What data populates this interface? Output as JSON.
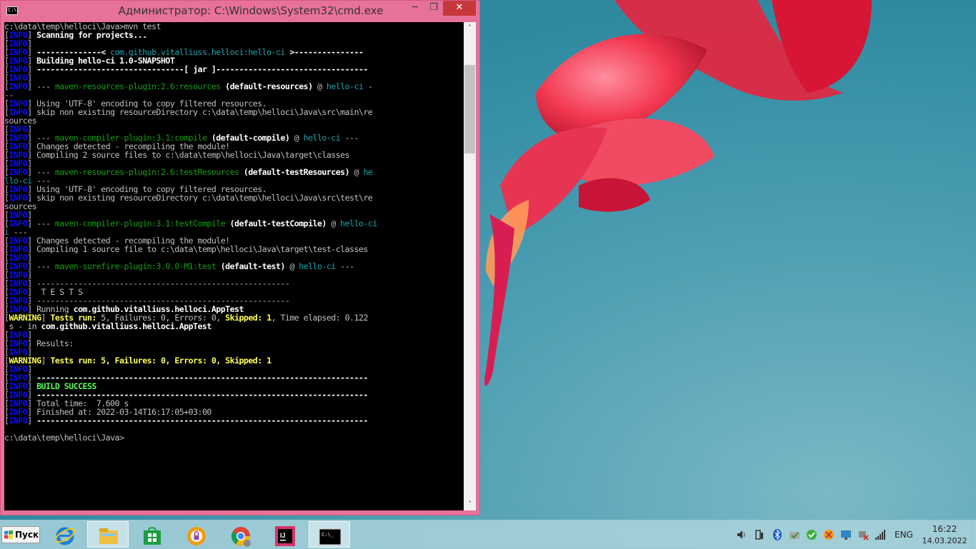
{
  "window": {
    "title": "Администратор: C:\\Windows\\System32\\cmd.exe",
    "icon_label": "C:\\.",
    "min_glyph": "─",
    "max_glyph": "❐",
    "close_glyph": "✕"
  },
  "console": {
    "lines": [
      [
        [
          "def",
          "c:\\data\\temp\\helloci\\Java>mvn test"
        ]
      ],
      [
        [
          "def",
          "["
        ],
        [
          "info",
          "INFO"
        ],
        [
          "def",
          "] "
        ],
        [
          "white",
          "Scanning for projects..."
        ]
      ],
      [
        [
          "def",
          "["
        ],
        [
          "info",
          "INFO"
        ],
        [
          "def",
          "]"
        ]
      ],
      [
        [
          "def",
          "["
        ],
        [
          "info",
          "INFO"
        ],
        [
          "def",
          "] "
        ],
        [
          "white",
          "--------------< "
        ],
        [
          "cyan",
          "com.github.vitalliuss.helloci:hello-ci"
        ],
        [
          "white",
          " >---------------"
        ]
      ],
      [
        [
          "def",
          "["
        ],
        [
          "info",
          "INFO"
        ],
        [
          "def",
          "] "
        ],
        [
          "white",
          "Building hello-ci 1.0-SNAPSHOT"
        ]
      ],
      [
        [
          "def",
          "["
        ],
        [
          "info",
          "INFO"
        ],
        [
          "def",
          "] "
        ],
        [
          "white",
          "--------------------------------[ jar ]---------------------------------"
        ]
      ],
      [
        [
          "def",
          "["
        ],
        [
          "info",
          "INFO"
        ],
        [
          "def",
          "]"
        ]
      ],
      [
        [
          "def",
          "["
        ],
        [
          "info",
          "INFO"
        ],
        [
          "def",
          "] "
        ],
        [
          "def",
          "--- "
        ],
        [
          "green",
          "maven-resources-plugin:2.6:resources"
        ],
        [
          "white",
          " (default-resources)"
        ],
        [
          "def",
          " @ "
        ],
        [
          "cyan",
          "hello-ci"
        ],
        [
          "def",
          " -"
        ]
      ],
      [
        [
          "def",
          "--"
        ]
      ],
      [
        [
          "def",
          "["
        ],
        [
          "info",
          "INFO"
        ],
        [
          "def",
          "] "
        ],
        [
          "def",
          "Using 'UTF-8' encoding to copy filtered resources."
        ]
      ],
      [
        [
          "def",
          "["
        ],
        [
          "info",
          "INFO"
        ],
        [
          "def",
          "] "
        ],
        [
          "def",
          "skip non existing resourceDirectory c:\\data\\temp\\helloci\\Java\\src\\main\\re"
        ]
      ],
      [
        [
          "def",
          "sources"
        ]
      ],
      [
        [
          "def",
          "["
        ],
        [
          "info",
          "INFO"
        ],
        [
          "def",
          "]"
        ]
      ],
      [
        [
          "def",
          "["
        ],
        [
          "info",
          "INFO"
        ],
        [
          "def",
          "] "
        ],
        [
          "def",
          "--- "
        ],
        [
          "green",
          "maven-compiler-plugin:3.1:compile"
        ],
        [
          "white",
          " (default-compile)"
        ],
        [
          "def",
          " @ "
        ],
        [
          "cyan",
          "hello-ci"
        ],
        [
          "def",
          " ---"
        ]
      ],
      [
        [
          "def",
          "["
        ],
        [
          "info",
          "INFO"
        ],
        [
          "def",
          "] "
        ],
        [
          "def",
          "Changes detected - recompiling the module!"
        ]
      ],
      [
        [
          "def",
          "["
        ],
        [
          "info",
          "INFO"
        ],
        [
          "def",
          "] "
        ],
        [
          "def",
          "Compiling 2 source files to c:\\data\\temp\\helloci\\Java\\target\\classes"
        ]
      ],
      [
        [
          "def",
          "["
        ],
        [
          "info",
          "INFO"
        ],
        [
          "def",
          "]"
        ]
      ],
      [
        [
          "def",
          "["
        ],
        [
          "info",
          "INFO"
        ],
        [
          "def",
          "] "
        ],
        [
          "def",
          "--- "
        ],
        [
          "green",
          "maven-resources-plugin:2.6:testResources"
        ],
        [
          "white",
          " (default-testResources)"
        ],
        [
          "def",
          " @ "
        ],
        [
          "cyan",
          "he"
        ]
      ],
      [
        [
          "cyan",
          "llo-ci"
        ],
        [
          "def",
          " ---"
        ]
      ],
      [
        [
          "def",
          "["
        ],
        [
          "info",
          "INFO"
        ],
        [
          "def",
          "] "
        ],
        [
          "def",
          "Using 'UTF-8' encoding to copy filtered resources."
        ]
      ],
      [
        [
          "def",
          "["
        ],
        [
          "info",
          "INFO"
        ],
        [
          "def",
          "] "
        ],
        [
          "def",
          "skip non existing resourceDirectory c:\\data\\temp\\helloci\\Java\\src\\test\\re"
        ]
      ],
      [
        [
          "def",
          "sources"
        ]
      ],
      [
        [
          "def",
          "["
        ],
        [
          "info",
          "INFO"
        ],
        [
          "def",
          "]"
        ]
      ],
      [
        [
          "def",
          "["
        ],
        [
          "info",
          "INFO"
        ],
        [
          "def",
          "] "
        ],
        [
          "def",
          "--- "
        ],
        [
          "green",
          "maven-compiler-plugin:3.1:testCompile"
        ],
        [
          "white",
          " (default-testCompile)"
        ],
        [
          "def",
          " @ "
        ],
        [
          "cyan",
          "hello-ci"
        ]
      ],
      [
        [
          "cyan",
          "i"
        ],
        [
          "def",
          " ---"
        ]
      ],
      [
        [
          "def",
          "["
        ],
        [
          "info",
          "INFO"
        ],
        [
          "def",
          "] "
        ],
        [
          "def",
          "Changes detected - recompiling the module!"
        ]
      ],
      [
        [
          "def",
          "["
        ],
        [
          "info",
          "INFO"
        ],
        [
          "def",
          "] "
        ],
        [
          "def",
          "Compiling 1 source file to c:\\data\\temp\\helloci\\Java\\target\\test-classes"
        ]
      ],
      [
        [
          "def",
          "["
        ],
        [
          "info",
          "INFO"
        ],
        [
          "def",
          "]"
        ]
      ],
      [
        [
          "def",
          "["
        ],
        [
          "info",
          "INFO"
        ],
        [
          "def",
          "] "
        ],
        [
          "def",
          "--- "
        ],
        [
          "green",
          "maven-surefire-plugin:3.0.0-M1:test"
        ],
        [
          "white",
          " (default-test)"
        ],
        [
          "def",
          " @ "
        ],
        [
          "cyan",
          "hello-ci"
        ],
        [
          "def",
          " ---"
        ]
      ],
      [
        [
          "def",
          "["
        ],
        [
          "info",
          "INFO"
        ],
        [
          "def",
          "]"
        ]
      ],
      [
        [
          "def",
          "["
        ],
        [
          "info",
          "INFO"
        ],
        [
          "def",
          "] "
        ],
        [
          "def",
          "-------------------------------------------------------"
        ]
      ],
      [
        [
          "def",
          "["
        ],
        [
          "info",
          "INFO"
        ],
        [
          "def",
          "] "
        ],
        [
          "def",
          " T E S T S"
        ]
      ],
      [
        [
          "def",
          "["
        ],
        [
          "info",
          "INFO"
        ],
        [
          "def",
          "] "
        ],
        [
          "def",
          "-------------------------------------------------------"
        ]
      ],
      [
        [
          "def",
          "["
        ],
        [
          "info",
          "INFO"
        ],
        [
          "def",
          "] "
        ],
        [
          "def",
          "Running "
        ],
        [
          "white",
          "com.github.vitalliuss.helloci.AppTest"
        ]
      ],
      [
        [
          "def",
          "["
        ],
        [
          "warn",
          "WARNING"
        ],
        [
          "def",
          "] "
        ],
        [
          "yellow",
          "Tests run: "
        ],
        [
          "def",
          "5, Failures: 0, Errors: 0, "
        ],
        [
          "yellow",
          "Skipped: 1"
        ],
        [
          "def",
          ", Time elapsed: 0.122"
        ]
      ],
      [
        [
          "def",
          " s - in "
        ],
        [
          "white",
          "com.github.vitalliuss.helloci.AppTest"
        ]
      ],
      [
        [
          "def",
          "["
        ],
        [
          "info",
          "INFO"
        ],
        [
          "def",
          "]"
        ]
      ],
      [
        [
          "def",
          "["
        ],
        [
          "info",
          "INFO"
        ],
        [
          "def",
          "] "
        ],
        [
          "def",
          "Results:"
        ]
      ],
      [
        [
          "def",
          "["
        ],
        [
          "info",
          "INFO"
        ],
        [
          "def",
          "]"
        ]
      ],
      [
        [
          "def",
          "["
        ],
        [
          "warn",
          "WARNING"
        ],
        [
          "def",
          "] "
        ],
        [
          "yellow",
          "Tests run: 5, Failures: 0, Errors: 0, Skipped: 1"
        ]
      ],
      [
        [
          "def",
          "["
        ],
        [
          "info",
          "INFO"
        ],
        [
          "def",
          "]"
        ]
      ],
      [
        [
          "def",
          "["
        ],
        [
          "info",
          "INFO"
        ],
        [
          "def",
          "] "
        ],
        [
          "white",
          "------------------------------------------------------------------------"
        ]
      ],
      [
        [
          "def",
          "["
        ],
        [
          "info",
          "INFO"
        ],
        [
          "def",
          "] "
        ],
        [
          "bgreen",
          "BUILD SUCCESS"
        ]
      ],
      [
        [
          "def",
          "["
        ],
        [
          "info",
          "INFO"
        ],
        [
          "def",
          "] "
        ],
        [
          "white",
          "------------------------------------------------------------------------"
        ]
      ],
      [
        [
          "def",
          "["
        ],
        [
          "info",
          "INFO"
        ],
        [
          "def",
          "] "
        ],
        [
          "def",
          "Total time:  7.600 s"
        ]
      ],
      [
        [
          "def",
          "["
        ],
        [
          "info",
          "INFO"
        ],
        [
          "def",
          "] "
        ],
        [
          "def",
          "Finished at: 2022-03-14T16:17:05+03:00"
        ]
      ],
      [
        [
          "def",
          "["
        ],
        [
          "info",
          "INFO"
        ],
        [
          "def",
          "] "
        ],
        [
          "white",
          "------------------------------------------------------------------------"
        ]
      ],
      [
        [
          "def",
          ""
        ]
      ],
      [
        [
          "def",
          "c:\\data\\temp\\helloci\\Java>"
        ]
      ]
    ]
  },
  "scrollbar": {
    "up_glyph": "˄",
    "down_glyph": "˅"
  },
  "taskbar": {
    "start_label": "Пуск",
    "items": [
      {
        "name": "internet-explorer-icon",
        "active": false
      },
      {
        "name": "file-explorer-icon",
        "active": true
      },
      {
        "name": "windows-store-icon",
        "active": false
      },
      {
        "name": "security-app-icon",
        "active": false
      },
      {
        "name": "chrome-icon",
        "active": false
      },
      {
        "name": "intellij-idea-icon",
        "active": false
      },
      {
        "name": "cmd-icon",
        "active": true
      }
    ],
    "intellij_label": "IJ",
    "cmd_label": "C:\\_",
    "tray": {
      "language": "ENG",
      "time": "16:22",
      "date": "14.03.2022"
    }
  },
  "colors": {
    "info": "#0a0aff",
    "warning": "#ffff54",
    "success": "#54ff54",
    "plugin": "#13a10e",
    "artifact": "#1aa6b0",
    "close_button": "#c7383b",
    "window_frame": "#e8719a"
  }
}
